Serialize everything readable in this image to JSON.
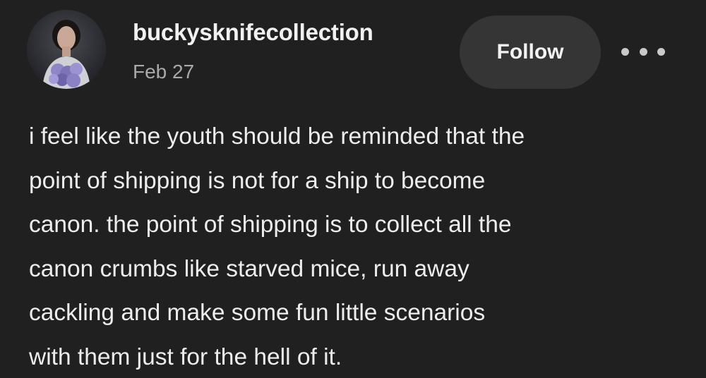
{
  "post": {
    "author": {
      "username": "buckysknifecollection",
      "date": "Feb 27"
    },
    "follow_label": "Follow",
    "more_icon": "ellipsis-icon",
    "body_lines": [
      "i feel like the youth should be reminded that the",
      "point of shipping is not for a ship to become",
      "canon. the point of shipping is to collect all the",
      "canon crumbs like starved mice, run away",
      "cackling and make some fun little scenarios",
      "with them just for the hell of it."
    ]
  },
  "colors": {
    "background": "#202020",
    "button_bg": "#353535",
    "text_primary": "#ededed",
    "text_secondary": "#a9a9a9"
  }
}
